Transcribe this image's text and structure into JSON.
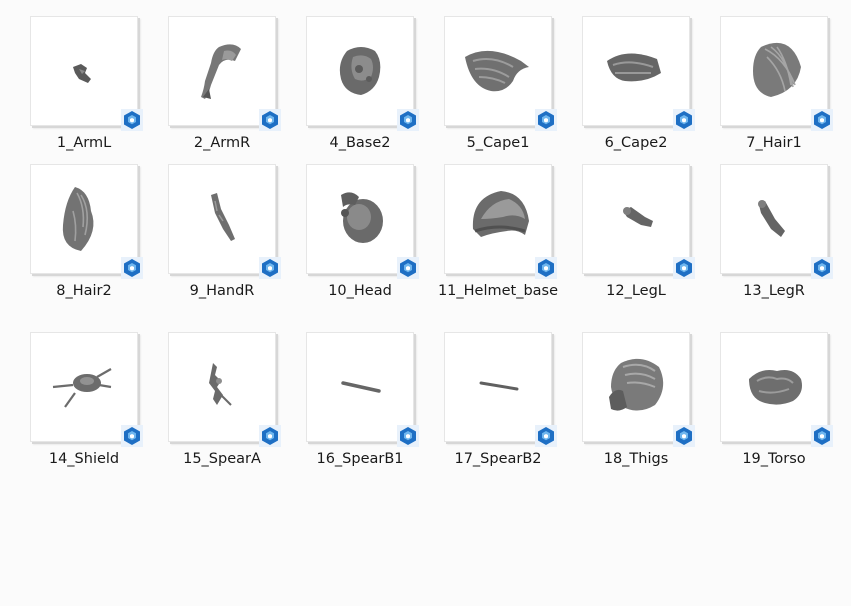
{
  "window": {
    "view": "large-icons"
  },
  "colors": {
    "badge_blue": "#1e6fc4",
    "badge_light": "#6fb6ee",
    "model_gray": "#6d6d6d"
  },
  "files": [
    {
      "name": "1_ArmL",
      "icon": "arm-left-model-icon"
    },
    {
      "name": "2_ArmR",
      "icon": "arm-right-model-icon"
    },
    {
      "name": "4_Base2",
      "icon": "base-model-icon"
    },
    {
      "name": "5_Cape1",
      "icon": "cape-model-icon"
    },
    {
      "name": "6_Cape2",
      "icon": "cape-model-icon"
    },
    {
      "name": "7_Hair1",
      "icon": "hair-model-icon"
    },
    {
      "name": "8_Hair2",
      "icon": "hair-model-icon"
    },
    {
      "name": "9_HandR",
      "icon": "hand-model-icon"
    },
    {
      "name": "10_Head",
      "icon": "head-model-icon"
    },
    {
      "name": "11_Helmet_base",
      "icon": "helmet-model-icon"
    },
    {
      "name": "12_LegL",
      "icon": "leg-left-model-icon"
    },
    {
      "name": "13_LegR",
      "icon": "leg-right-model-icon"
    },
    {
      "name": "14_Shield",
      "icon": "shield-model-icon"
    },
    {
      "name": "15_SpearA",
      "icon": "spear-model-icon"
    },
    {
      "name": "16_SpearB1",
      "icon": "spear-model-icon"
    },
    {
      "name": "17_SpearB2",
      "icon": "spear-model-icon"
    },
    {
      "name": "18_Thigs",
      "icon": "thighs-model-icon"
    },
    {
      "name": "19_Torso",
      "icon": "torso-model-icon"
    }
  ]
}
